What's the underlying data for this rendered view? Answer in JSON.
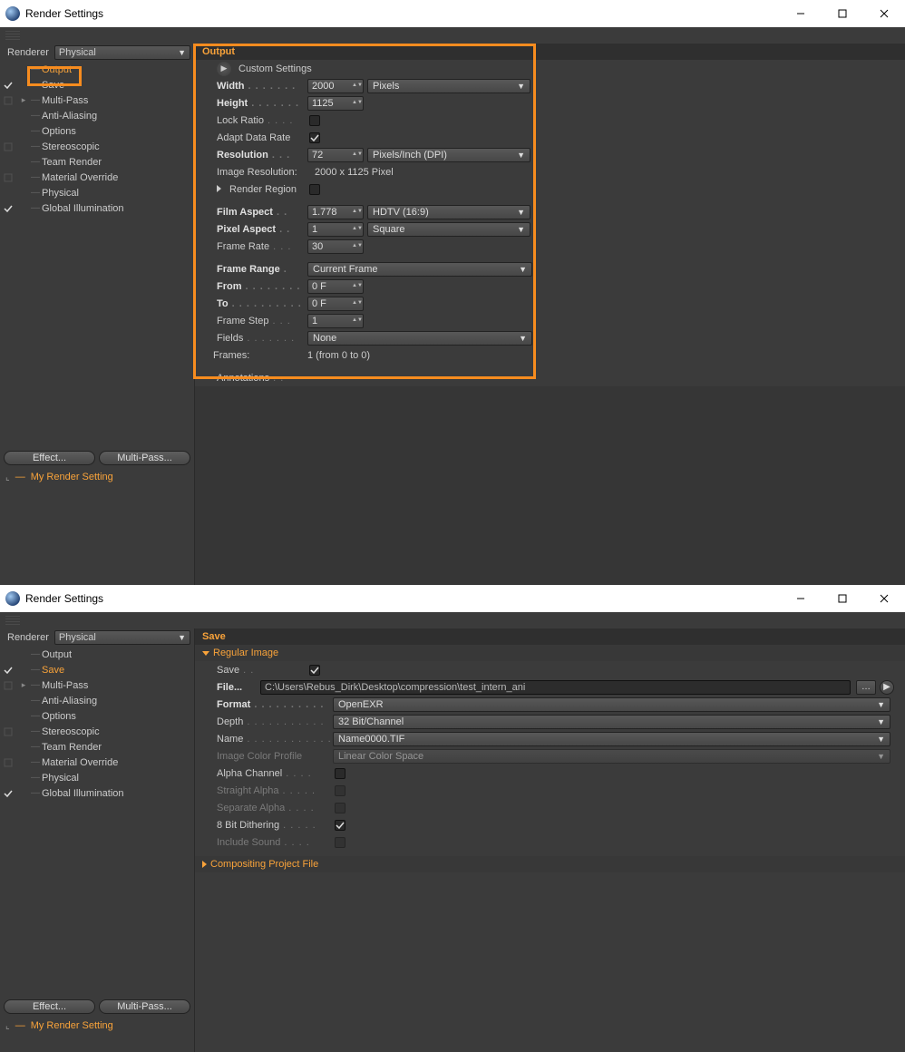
{
  "title": "Render Settings",
  "renderer": {
    "label": "Renderer",
    "value": "Physical"
  },
  "sidebar_items": [
    "Output",
    "Save",
    "Multi-Pass",
    "Anti-Aliasing",
    "Options",
    "Stereoscopic",
    "Team Render",
    "Material Override",
    "Physical",
    "Global Illumination"
  ],
  "buttons": {
    "effect": "Effect...",
    "multipass": "Multi-Pass..."
  },
  "setting_name": "My Render Setting",
  "output": {
    "header": "Output",
    "custom": "Custom Settings",
    "width_l": "Width",
    "width_v": "2000",
    "width_u": "Pixels",
    "height_l": "Height",
    "height_v": "1125",
    "lock_l": "Lock Ratio",
    "adapt_l": "Adapt Data Rate",
    "res_l": "Resolution",
    "res_v": "72",
    "res_u": "Pixels/Inch (DPI)",
    "imgres_l": "Image Resolution:",
    "imgres_v": "2000 x 1125 Pixel",
    "rreg_l": "Render Region",
    "film_l": "Film Aspect",
    "film_v": "1.778",
    "film_u": "HDTV (16:9)",
    "pix_l": "Pixel Aspect",
    "pix_v": "1",
    "pix_u": "Square",
    "fr_l": "Frame Rate",
    "fr_v": "30",
    "range_l": "Frame Range",
    "range_v": "Current Frame",
    "from_l": "From",
    "from_v": "0 F",
    "to_l": "To",
    "to_v": "0 F",
    "step_l": "Frame Step",
    "step_v": "1",
    "fields_l": "Fields",
    "fields_v": "None",
    "frames_l": "Frames:",
    "frames_v": "1 (from 0 to 0)",
    "annot_l": "Annotations"
  },
  "save": {
    "header": "Save",
    "regimg": "Regular Image",
    "save_l": "Save",
    "file_l": "File...",
    "file_v": "C:\\Users\\Rebus_Dirk\\Desktop\\compression\\test_intern_ani",
    "format_l": "Format",
    "format_v": "OpenEXR",
    "depth_l": "Depth",
    "depth_v": "32 Bit/Channel",
    "name_l": "Name",
    "name_v": "Name0000.TIF",
    "profile_l": "Image Color Profile",
    "profile_v": "Linear Color Space",
    "alpha_l": "Alpha Channel",
    "straight_l": "Straight Alpha",
    "separate_l": "Separate Alpha",
    "dith_l": "8 Bit Dithering",
    "sound_l": "Include Sound",
    "comp_l": "Compositing Project File"
  }
}
